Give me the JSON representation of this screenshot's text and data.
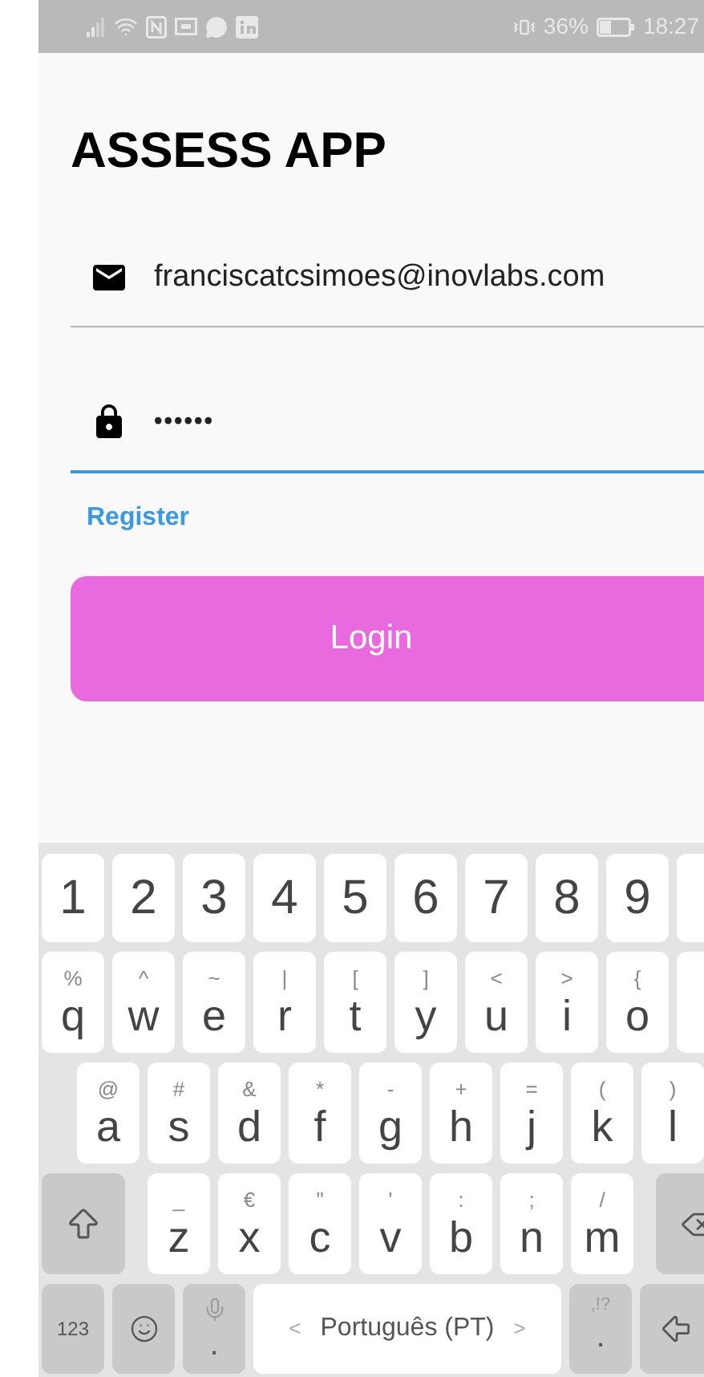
{
  "status_bar": {
    "battery": "36%",
    "time": "18:27"
  },
  "title": "ASSESS APP",
  "fields": [
    {
      "kind": "email",
      "value": "franciscatcsimoes@inovlabs.com",
      "focused": false
    },
    {
      "kind": "password",
      "value": "••••••",
      "focused": true
    }
  ],
  "register_link": "Register",
  "login_button": "Login",
  "keyboard": {
    "rows": [
      [
        {
          "kind": "char",
          "main": "1"
        },
        {
          "kind": "char",
          "main": "2"
        },
        {
          "kind": "char",
          "main": "3"
        },
        {
          "kind": "char",
          "main": "4"
        },
        {
          "kind": "char",
          "main": "5"
        },
        {
          "kind": "char",
          "main": "6"
        },
        {
          "kind": "char",
          "main": "7"
        },
        {
          "kind": "char",
          "main": "8"
        },
        {
          "kind": "char",
          "main": "9"
        },
        {
          "kind": "cut"
        }
      ],
      [
        {
          "kind": "char",
          "main": "q",
          "alt": "%"
        },
        {
          "kind": "char",
          "main": "w",
          "alt": "^"
        },
        {
          "kind": "char",
          "main": "e",
          "alt": "~"
        },
        {
          "kind": "char",
          "main": "r",
          "alt": "|"
        },
        {
          "kind": "char",
          "main": "t",
          "alt": "["
        },
        {
          "kind": "char",
          "main": "y",
          "alt": "]"
        },
        {
          "kind": "char",
          "main": "u",
          "alt": "<"
        },
        {
          "kind": "char",
          "main": "i",
          "alt": ">"
        },
        {
          "kind": "char",
          "main": "o",
          "alt": "{"
        },
        {
          "kind": "cut"
        }
      ],
      [
        {
          "kind": "char",
          "main": "a",
          "alt": "@"
        },
        {
          "kind": "char",
          "main": "s",
          "alt": "#"
        },
        {
          "kind": "char",
          "main": "d",
          "alt": "&"
        },
        {
          "kind": "char",
          "main": "f",
          "alt": "*"
        },
        {
          "kind": "char",
          "main": "g",
          "alt": "-"
        },
        {
          "kind": "char",
          "main": "h",
          "alt": "+"
        },
        {
          "kind": "char",
          "main": "j",
          "alt": "="
        },
        {
          "kind": "char",
          "main": "k",
          "alt": "("
        },
        {
          "kind": "char",
          "main": "l",
          "alt": ")"
        }
      ],
      [
        {
          "kind": "shift"
        },
        {
          "kind": "char",
          "main": "z",
          "alt": "_"
        },
        {
          "kind": "char",
          "main": "x",
          "alt": "€"
        },
        {
          "kind": "char",
          "main": "c",
          "alt": "\""
        },
        {
          "kind": "char",
          "main": "v",
          "alt": "'"
        },
        {
          "kind": "char",
          "main": "b",
          "alt": ":"
        },
        {
          "kind": "char",
          "main": "n",
          "alt": ";"
        },
        {
          "kind": "char",
          "main": "m",
          "alt": "/"
        },
        {
          "kind": "backspace"
        }
      ],
      [
        {
          "kind": "mode",
          "main": "123"
        },
        {
          "kind": "emoji"
        },
        {
          "kind": "mic",
          "main": "."
        },
        {
          "kind": "space",
          "main": "Português (PT)",
          "prev": "<",
          "next": ">"
        },
        {
          "kind": "punct",
          "main": ".",
          "alt": ",!?"
        },
        {
          "kind": "enter"
        }
      ]
    ]
  }
}
